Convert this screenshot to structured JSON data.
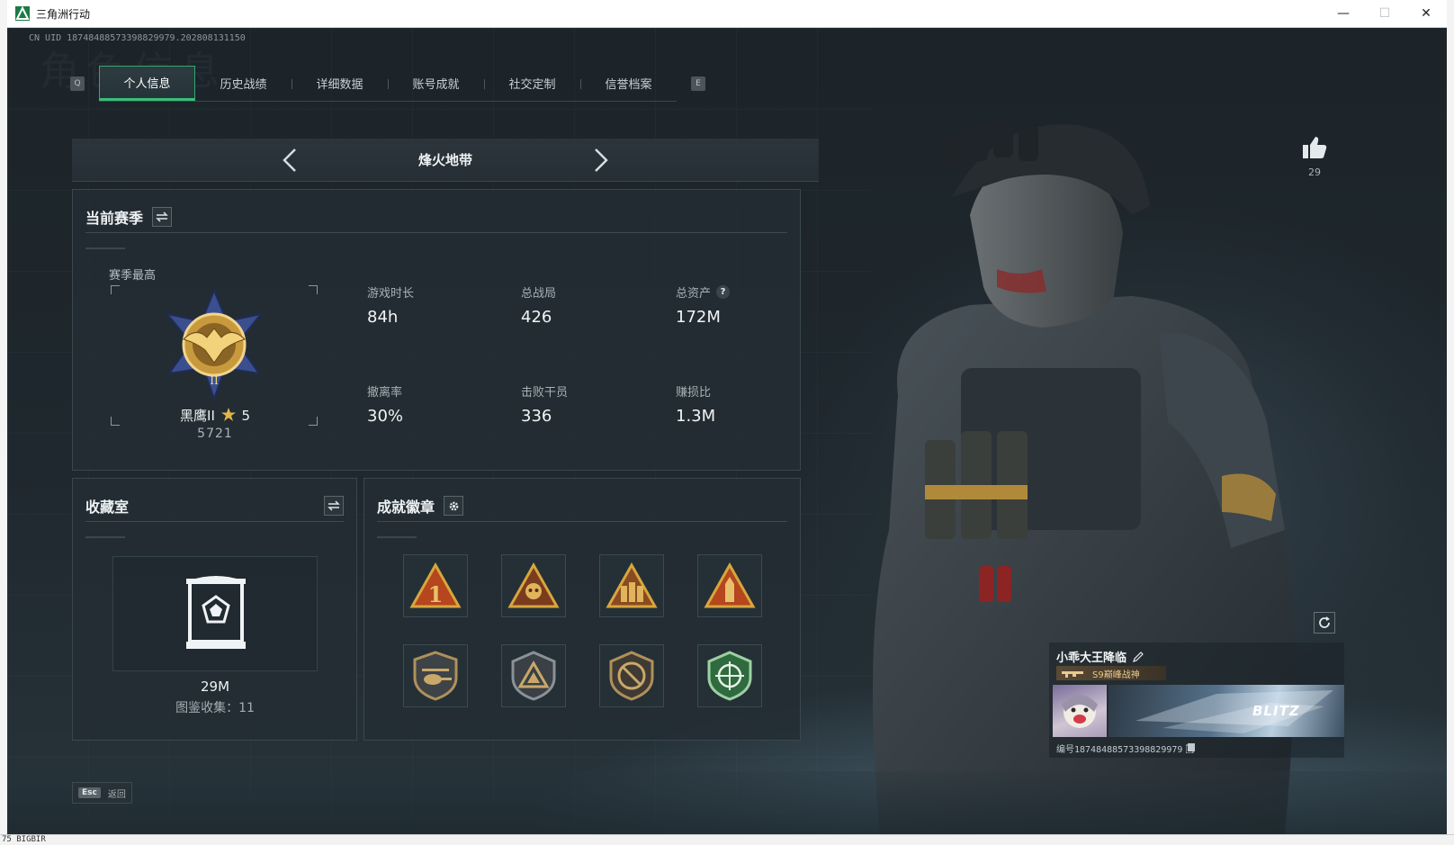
{
  "window": {
    "title": "三角洲行动",
    "minimize": "—",
    "maximize": "☐",
    "close": "✕"
  },
  "uid": "CN UID 18748488573398829979.202808131150",
  "watermark": "角色信息",
  "tabs": {
    "left_key": "Q",
    "right_key": "E",
    "items": [
      {
        "label": "个人信息",
        "active": true
      },
      {
        "label": "历史战绩",
        "active": false
      },
      {
        "label": "详细数据",
        "active": false
      },
      {
        "label": "账号成就",
        "active": false
      },
      {
        "label": "社交定制",
        "active": false
      },
      {
        "label": "信誉档案",
        "active": false
      }
    ]
  },
  "map": {
    "name": "烽火地带"
  },
  "season": {
    "title": "当前赛季",
    "best_label": "赛季最高",
    "rank_name": "黑鹰II",
    "rank_stars": "5",
    "rank_score": "5721",
    "stats": [
      {
        "label": "游戏时长",
        "value": "84h",
        "help": false
      },
      {
        "label": "总战局",
        "value": "426",
        "help": false
      },
      {
        "label": "总资产",
        "value": "172M",
        "help": true
      },
      {
        "label": "撤离率",
        "value": "30%",
        "help": false
      },
      {
        "label": "击败干员",
        "value": "336",
        "help": false
      },
      {
        "label": "赚损比",
        "value": "1.3M",
        "help": false
      }
    ],
    "help_glyph": "?"
  },
  "collection": {
    "title": "收藏室",
    "value": "29M",
    "count_label": "图鉴收集：11"
  },
  "badges": {
    "title": "成就徽章",
    "items": [
      {
        "icon": "rank-1-triangle-badge-icon"
      },
      {
        "icon": "skull-triangle-badge-icon"
      },
      {
        "icon": "soldiers-triangle-badge-icon"
      },
      {
        "icon": "ammo-triangle-badge-icon"
      },
      {
        "icon": "helicopter-shield-badge-icon"
      },
      {
        "icon": "delta-shield-badge-icon"
      },
      {
        "icon": "no-weapon-shield-badge-icon"
      },
      {
        "icon": "target-shield-badge-icon"
      }
    ]
  },
  "likes": {
    "count": "29"
  },
  "profile": {
    "player_name": "小乖大王降临",
    "title_chip": "S9巅峰战神",
    "banner_text": "BLITZ",
    "player_id": "编号18748488573398829979"
  },
  "footer": {
    "esc_key": "Esc",
    "esc_label": "返回"
  },
  "taskbar_text": "75 BIGBIR",
  "colors": {
    "accent": "#3bbf78",
    "panel": "#232d33",
    "gold": "#d8a63c",
    "text": "#eef2f4"
  }
}
